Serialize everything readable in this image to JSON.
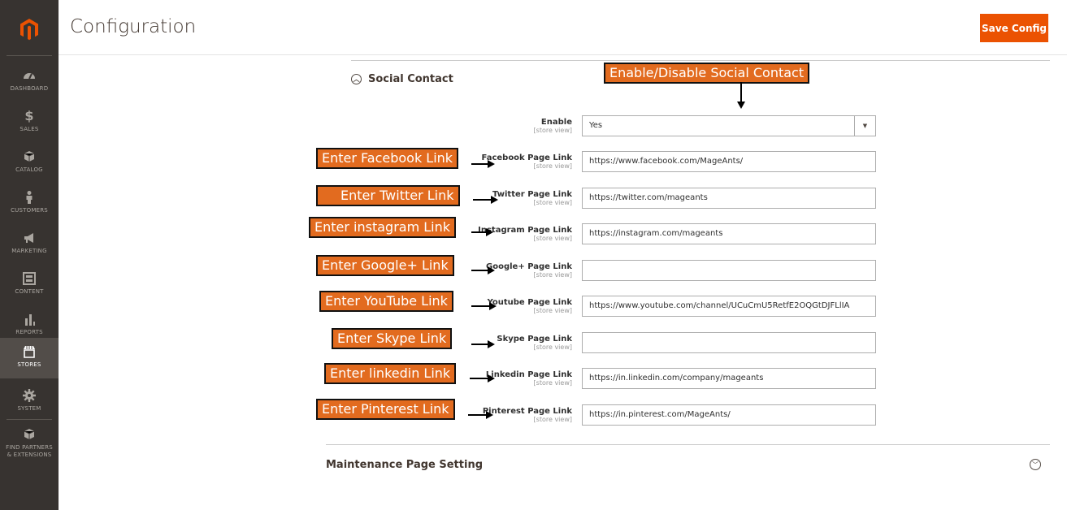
{
  "header": {
    "title": "Configuration",
    "save_label": "Save Config"
  },
  "sidebar": {
    "items": [
      {
        "label": "DASHBOARD",
        "icon": "dashboard-icon"
      },
      {
        "label": "SALES",
        "icon": "dollar-icon"
      },
      {
        "label": "CATALOG",
        "icon": "cube-icon"
      },
      {
        "label": "CUSTOMERS",
        "icon": "person-icon"
      },
      {
        "label": "MARKETING",
        "icon": "megaphone-icon"
      },
      {
        "label": "CONTENT",
        "icon": "layout-icon"
      },
      {
        "label": "REPORTS",
        "icon": "bar-chart-icon"
      },
      {
        "label": "STORES",
        "icon": "store-icon",
        "active": true
      },
      {
        "label": "SYSTEM",
        "icon": "gear-icon"
      },
      {
        "label": "FIND PARTNERS",
        "label2": "& EXTENSIONS",
        "icon": "box-icon"
      }
    ]
  },
  "section": {
    "title": "Social Contact"
  },
  "scope_label": "[store view]",
  "enable": {
    "label": "Enable",
    "value": "Yes"
  },
  "rows": [
    {
      "label": "Facebook Page Link",
      "value": "https://www.facebook.com/MageAnts/"
    },
    {
      "label": "Twitter Page Link",
      "value": "https://twitter.com/mageants"
    },
    {
      "label": "Instagram Page Link",
      "value": "https://instagram.com/mageants"
    },
    {
      "label": "Google+ Page Link",
      "value": ""
    },
    {
      "label": "Youtube Page Link",
      "value": "https://www.youtube.com/channel/UCuCmU5RetfE2OQGtDJFLlIA"
    },
    {
      "label": "Skype Page Link",
      "value": ""
    },
    {
      "label": "Linkedin Page Link",
      "value": "https://in.linkedin.com/company/mageants"
    },
    {
      "label": "Pinterest Page Link",
      "value": "https://in.pinterest.com/MageAnts/"
    }
  ],
  "callouts": {
    "enable": "Enable/Disable Social Contact",
    "facebook": "Enter Facebook Link",
    "twitter": "Enter Twitter Link",
    "instagram": "Enter instagram Link",
    "google": "Enter Google+ Link",
    "youtube": "Enter YouTube Link",
    "skype": "Enter Skype Link",
    "linkedin": "Enter linkedin Link",
    "pinterest": "Enter Pinterest Link"
  },
  "maintenance": {
    "title": "Maintenance Page Setting"
  },
  "colors": {
    "accent": "#eb5202",
    "sidebar": "#373330",
    "callout": "#e26b1f"
  }
}
